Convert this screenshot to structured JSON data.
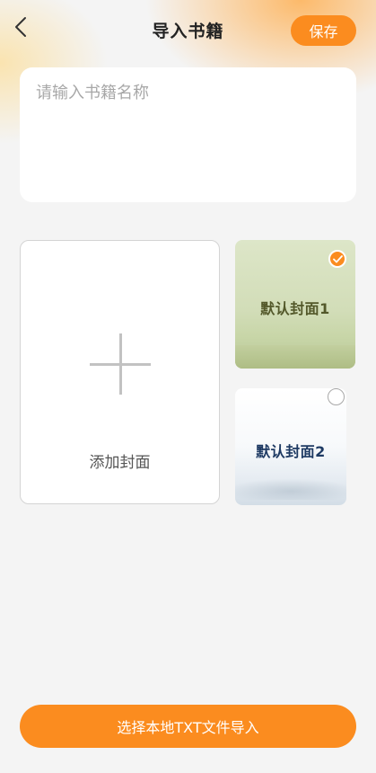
{
  "header": {
    "back_icon": "chevron-left-icon",
    "title": "导入书籍",
    "save_label": "保存"
  },
  "book_name": {
    "placeholder": "请输入书籍名称",
    "value": ""
  },
  "add_cover": {
    "icon": "plus-icon",
    "label": "添加封面"
  },
  "covers": [
    {
      "title": "默认封面1",
      "selected": true
    },
    {
      "title": "默认封面2",
      "selected": false
    }
  ],
  "import_button": {
    "label": "选择本地TXT文件导入"
  },
  "colors": {
    "accent": "#fb8c1f",
    "background": "#f4f4f4"
  }
}
